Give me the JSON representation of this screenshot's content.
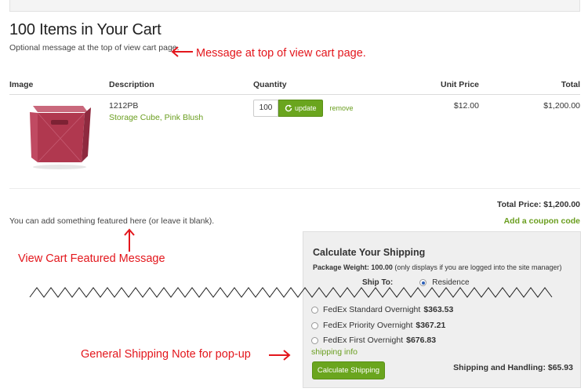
{
  "page": {
    "title": "100 Items in Your Cart",
    "top_message": "Optional message at the top of view cart page."
  },
  "annotations": {
    "top_message_note": "Message at top of view cart page.",
    "featured_note": "View Cart Featured Message",
    "shipping_note": "General Shipping Note for pop-up"
  },
  "table": {
    "headers": {
      "image": "Image",
      "description": "Description",
      "quantity": "Quantity",
      "unit_price": "Unit Price",
      "total": "Total"
    },
    "rows": [
      {
        "sku": "1212PB",
        "name": "Storage Cube, Pink Blush",
        "quantity": "100",
        "update_label": "update",
        "remove_label": "remove",
        "unit_price": "$12.00",
        "total": "$1,200.00"
      }
    ]
  },
  "summary": {
    "total_price": "Total Price: $1,200.00",
    "coupon_link": "Add a coupon code",
    "featured_message": "You can add something featured here (or leave it blank)."
  },
  "shipping": {
    "title": "Calculate Your Shipping",
    "package_weight_label": "Package Weight: 100.00",
    "package_weight_note": "(only displays if you are logged into the site manager)",
    "ship_to_label": "Ship To:",
    "ship_to_value": "Residence",
    "options": [
      {
        "name": "FedEx Standard Overnight",
        "price": "$363.53"
      },
      {
        "name": "FedEx Priority Overnight",
        "price": "$367.21"
      },
      {
        "name": "FedEx First Overnight",
        "price": "$676.83"
      }
    ],
    "info_link": "shipping info",
    "calc_button": "Calculate Shipping",
    "handling_total": "Shipping and Handling: $65.93"
  },
  "colors": {
    "accent_green": "#6aa51e",
    "link_green": "#6a9e1f",
    "annotation_red": "#e3161c",
    "product_pink": "#b0384f"
  }
}
